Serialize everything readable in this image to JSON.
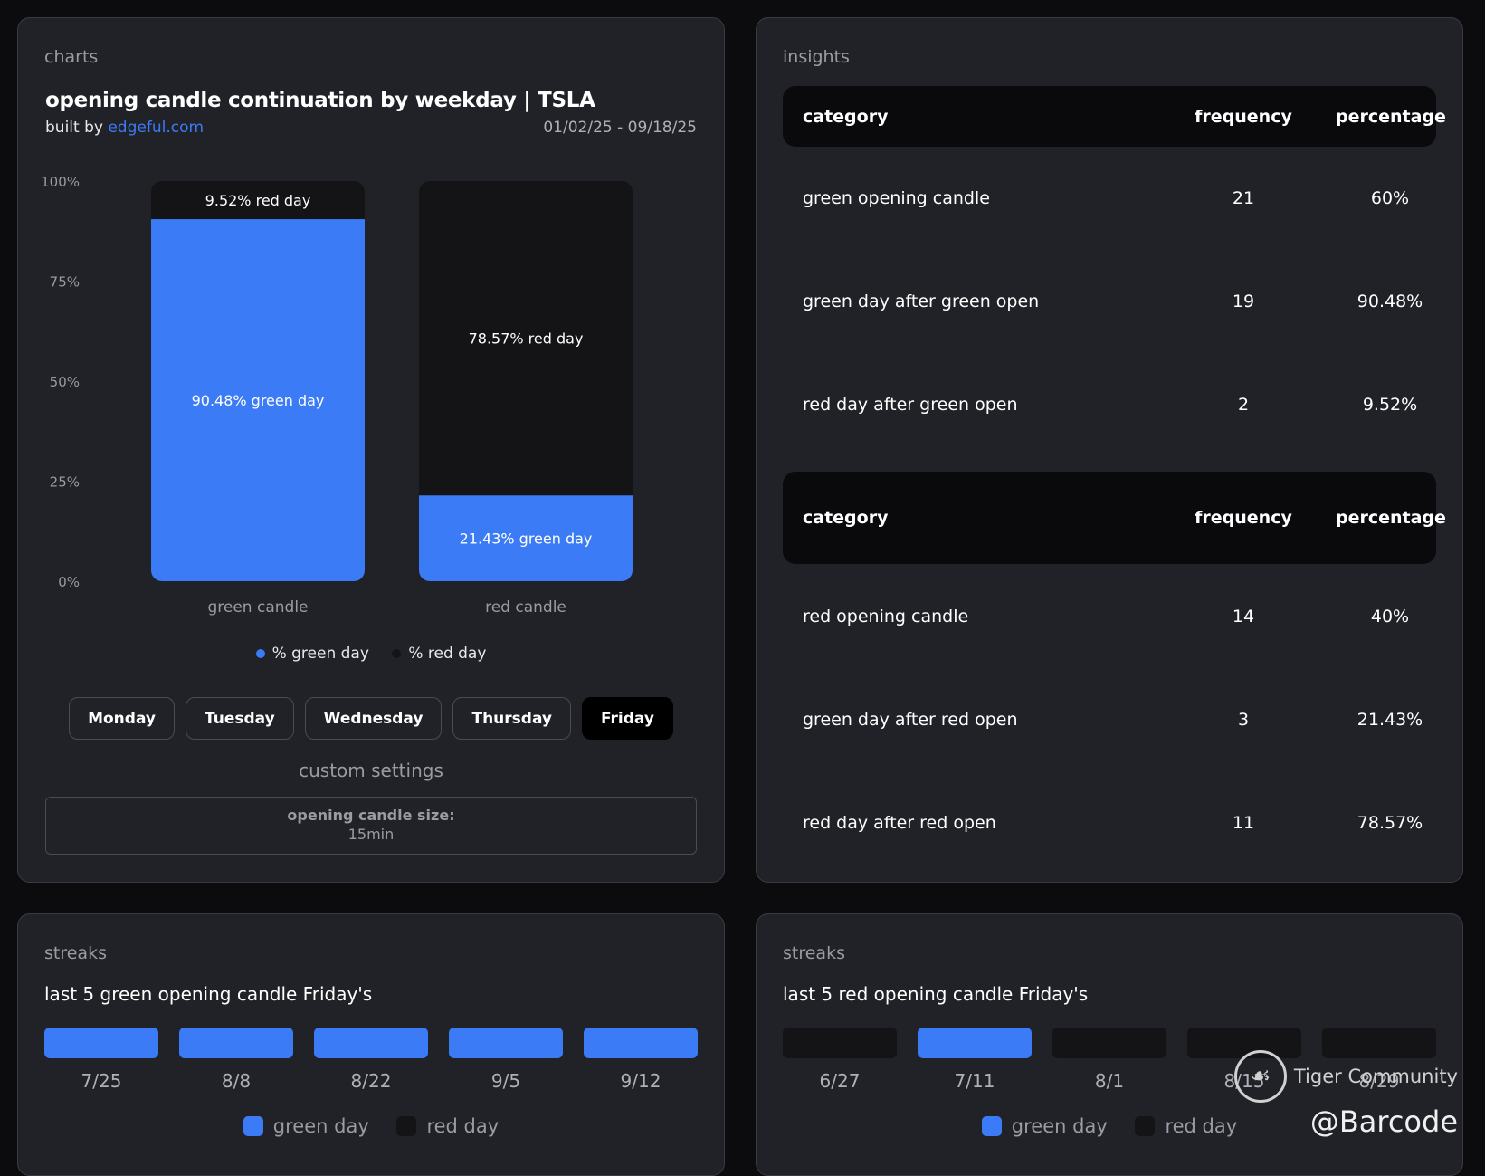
{
  "charts_card": {
    "label": "charts",
    "title": "opening candle continuation by weekday | TSLA",
    "built_by_prefix": "built by",
    "built_by_link": "edgeful.com",
    "date_range": "01/02/25 - 09/18/25",
    "legend": [
      {
        "label": "% green day",
        "color": "#3b7bf6"
      },
      {
        "label": "% red day",
        "color": "#141417"
      }
    ],
    "weekdays": [
      "Monday",
      "Tuesday",
      "Wednesday",
      "Thursday",
      "Friday"
    ],
    "active_weekday": "Friday",
    "custom_settings": {
      "title": "custom settings",
      "label": "opening candle size:",
      "value": "15min"
    }
  },
  "chart_data": {
    "type": "bar",
    "stacked": true,
    "categories": [
      "green candle",
      "red candle"
    ],
    "series": [
      {
        "name": "% green day",
        "values": [
          90.48,
          21.43
        ],
        "labels": [
          "90.48% green day",
          "21.43% green day"
        ],
        "color": "#3b7bf6"
      },
      {
        "name": "% red day",
        "values": [
          9.52,
          78.57
        ],
        "labels": [
          "9.52% red day",
          "78.57% red day"
        ],
        "color": "#141417"
      }
    ],
    "yticks": [
      "0%",
      "25%",
      "50%",
      "75%",
      "100%"
    ],
    "ylim": [
      0,
      100
    ],
    "legend_position": "bottom"
  },
  "insights_card": {
    "label": "insights",
    "headers": [
      "category",
      "frequency",
      "percentage"
    ],
    "green_group": [
      [
        "green opening candle",
        "21",
        "60%"
      ],
      [
        "green day after green open",
        "19",
        "90.48%"
      ],
      [
        "red day after green open",
        "2",
        "9.52%"
      ]
    ],
    "red_group": [
      [
        "red opening candle",
        "14",
        "40%"
      ],
      [
        "green day after red open",
        "3",
        "21.43%"
      ],
      [
        "red day after red open",
        "11",
        "78.57%"
      ]
    ]
  },
  "streaks_green": {
    "label": "streaks",
    "title": "last 5 green opening candle Friday's",
    "items": [
      {
        "date": "7/25",
        "result": "green"
      },
      {
        "date": "8/8",
        "result": "green"
      },
      {
        "date": "8/22",
        "result": "green"
      },
      {
        "date": "9/5",
        "result": "green"
      },
      {
        "date": "9/12",
        "result": "green"
      }
    ],
    "legend": [
      {
        "label": "green day",
        "color": "#3b7bf6"
      },
      {
        "label": "red day",
        "color": "#141417"
      }
    ]
  },
  "streaks_red": {
    "label": "streaks",
    "title": "last 5 red opening candle Friday's",
    "items": [
      {
        "date": "6/27",
        "result": "red"
      },
      {
        "date": "7/11",
        "result": "green"
      },
      {
        "date": "8/1",
        "result": "red"
      },
      {
        "date": "8/15",
        "result": "red"
      },
      {
        "date": "8/29",
        "result": "red"
      }
    ],
    "legend": [
      {
        "label": "green day",
        "color": "#3b7bf6"
      },
      {
        "label": "red day",
        "color": "#141417"
      }
    ]
  },
  "watermark": {
    "brand": "Tiger Community",
    "handle": "@Barcode"
  }
}
